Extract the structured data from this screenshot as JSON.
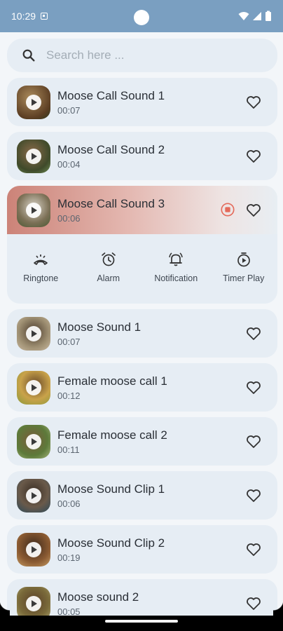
{
  "status": {
    "time": "10:29"
  },
  "search": {
    "placeholder": "Search here ..."
  },
  "sounds": [
    {
      "title": "Moose Call Sound 1",
      "duration": "00:07"
    },
    {
      "title": "Moose Call Sound 2",
      "duration": "00:04"
    },
    {
      "title": "Moose Call Sound 3",
      "duration": "00:06"
    },
    {
      "title": "Moose Sound 1",
      "duration": "00:07"
    },
    {
      "title": "Female moose call 1",
      "duration": "00:12"
    },
    {
      "title": "Female moose call 2",
      "duration": "00:11"
    },
    {
      "title": "Moose Sound Clip 1",
      "duration": "00:06"
    },
    {
      "title": "Moose Sound Clip 2",
      "duration": "00:19"
    },
    {
      "title": "Moose sound 2",
      "duration": "00:05"
    }
  ],
  "actions": {
    "ringtone": "Ringtone",
    "alarm": "Alarm",
    "notification": "Notification",
    "timer_play": "Timer Play"
  },
  "colors": {
    "status_bar": "#7a9fc1",
    "card_bg": "#e6edf4",
    "playing_accent": "#cc8378",
    "stop_icon": "#e46a5a"
  }
}
